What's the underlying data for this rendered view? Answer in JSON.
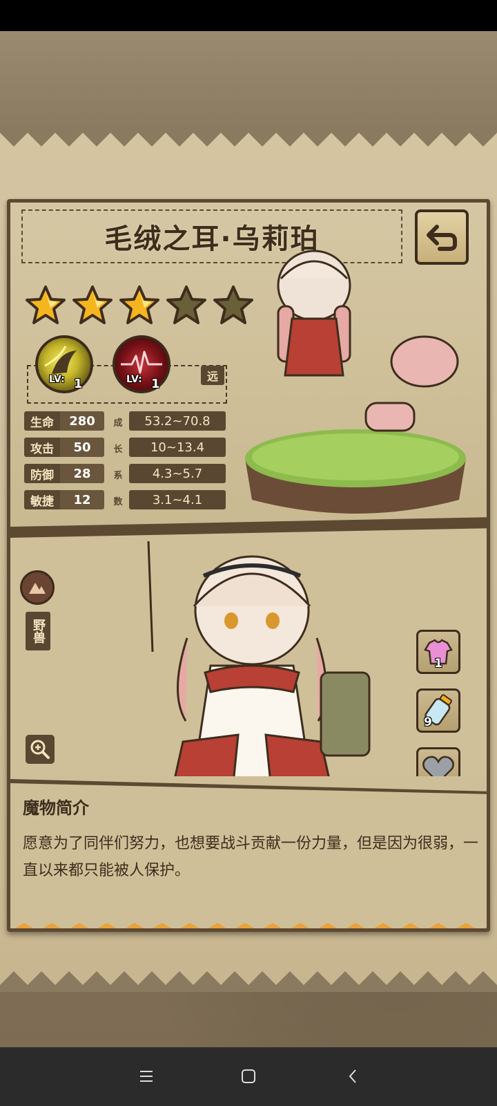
{
  "monster": {
    "name": "毛绒之耳·乌莉珀",
    "stars_filled": 3,
    "stars_total": 5,
    "range_badge": "远",
    "type_tag": "野兽"
  },
  "skills": [
    {
      "lv_label": "LV:",
      "level": "1",
      "icon": "dash-skill-icon"
    },
    {
      "lv_label": "LV:",
      "level": "1",
      "icon": "heartbeat-skill-icon"
    }
  ],
  "stats": [
    {
      "name": "生命",
      "value": "280",
      "growth": "53.2~70.8"
    },
    {
      "name": "攻击",
      "value": "50",
      "growth": "10~13.4"
    },
    {
      "name": "防御",
      "value": "28",
      "growth": "4.3~5.7"
    },
    {
      "name": "敏捷",
      "value": "12",
      "growth": "3.1~4.1"
    }
  ],
  "growth_label": [
    "成",
    "长",
    "系",
    "数"
  ],
  "side_items": [
    {
      "icon": "outfit-icon",
      "count": "1"
    },
    {
      "icon": "potion-bottle-icon",
      "count": "9"
    },
    {
      "icon": "heart-icon",
      "count": ""
    }
  ],
  "description": {
    "title": "魔物简介",
    "text": "愿意为了同伴们努力，也想要战斗贡献一份力量，但是因为很弱，一直以来都只能被人保护。"
  },
  "colors": {
    "frame": "#5d4932",
    "parchment": "#cfc09a",
    "stat_bg": "#5a4731",
    "zigzag": "#e9a23b"
  }
}
